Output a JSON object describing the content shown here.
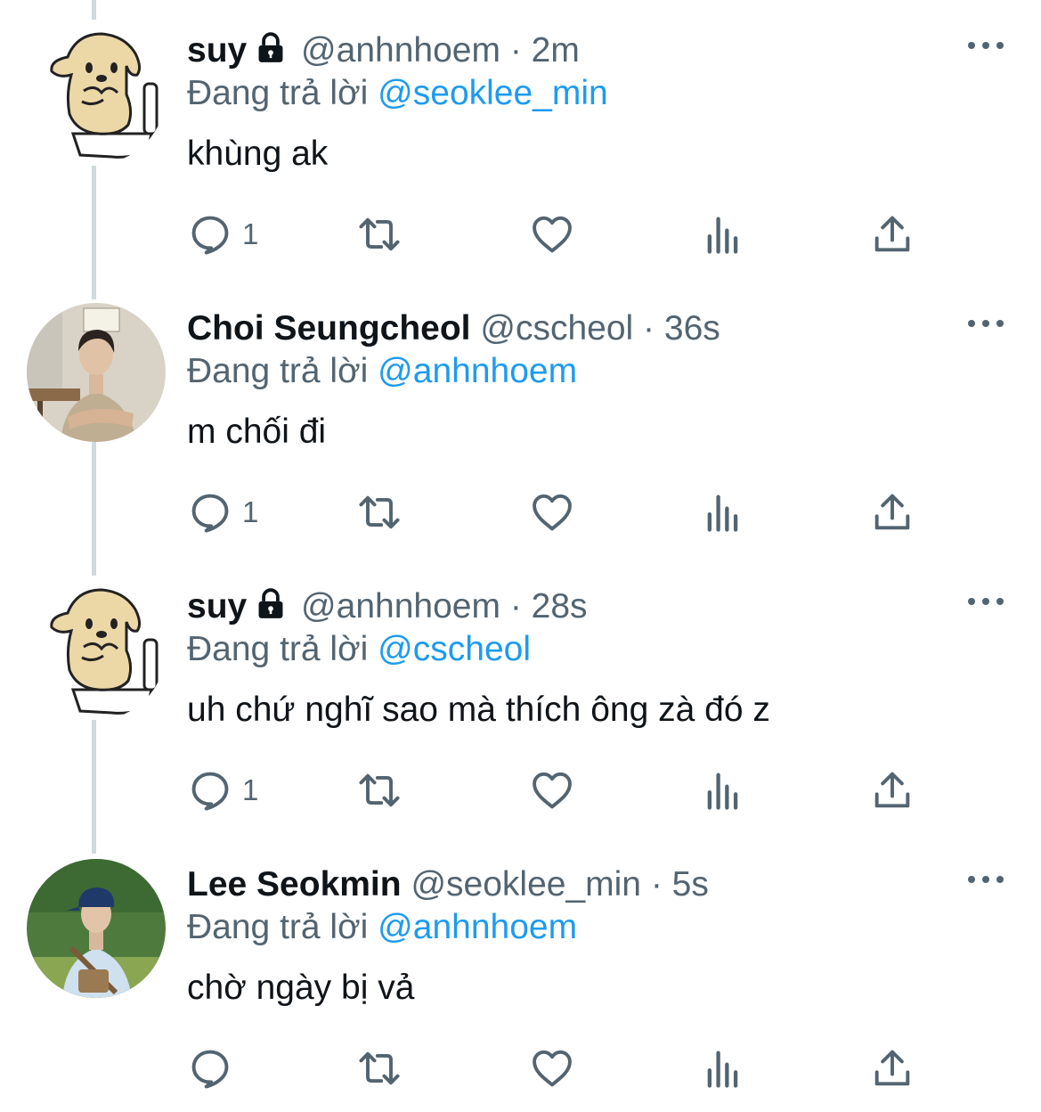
{
  "reply_prefix": "Đang trả lời",
  "colors": {
    "accent": "#1d9bf0",
    "secondary_text": "#536471",
    "thread_line": "#cfd9de"
  },
  "tweets": [
    {
      "name": "suy",
      "protected": true,
      "handle": "@anhnhoem",
      "separator": "·",
      "time": "2m",
      "replying_to": "@seoklee_min",
      "text": "khùng ak",
      "reply_count": "1",
      "avatar": "dog-on-toilet-drawing"
    },
    {
      "name": "Choi Seungcheol",
      "protected": false,
      "handle": "@cscheol",
      "separator": "·",
      "time": "36s",
      "replying_to": "@anhnhoem",
      "text": "m chối đi",
      "reply_count": "1",
      "avatar": "man-photo"
    },
    {
      "name": "suy",
      "protected": true,
      "handle": "@anhnhoem",
      "separator": "·",
      "time": "28s",
      "replying_to": "@cscheol",
      "text": "uh chứ nghĩ sao mà thích ông zà đó z",
      "reply_count": "1",
      "avatar": "dog-on-toilet-drawing"
    },
    {
      "name": "Lee Seokmin",
      "protected": false,
      "handle": "@seoklee_min",
      "separator": "·",
      "time": "5s",
      "replying_to": "@anhnhoem",
      "text": "chờ ngày bị vả",
      "reply_count": "",
      "avatar": "man-with-cap-photo"
    }
  ]
}
